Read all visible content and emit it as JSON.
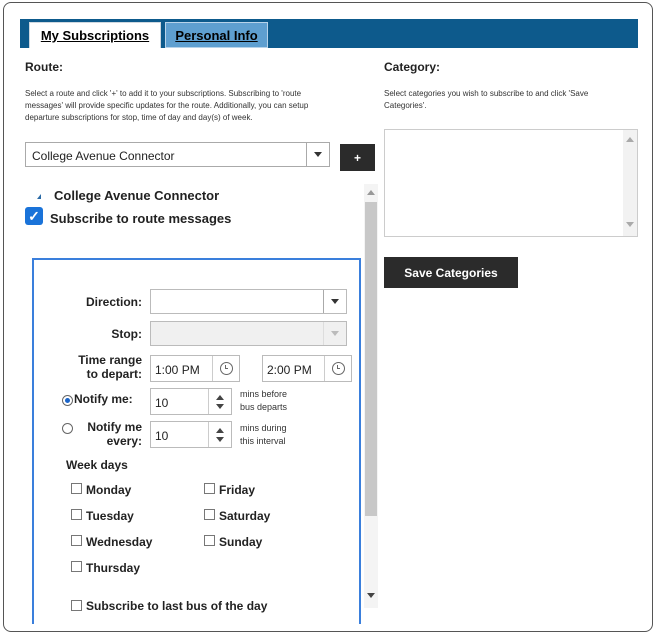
{
  "tabs": [
    {
      "label": "My Subscriptions",
      "active": true
    },
    {
      "label": "Personal Info",
      "active": false
    }
  ],
  "route": {
    "title": "Route:",
    "help_lines": [
      "Select a route and click '+' to add it to your subscriptions. Subscribing to 'route",
      "messages' will provide specific updates for the route. Additionally, you can setup",
      "departure subscriptions for stop, time of day and day(s) of week."
    ],
    "selected": "College Avenue Connector",
    "add_label": "+"
  },
  "route_item": {
    "name": "College Avenue Connector",
    "subscribe_label": "Subscribe to route messages",
    "subscribe_checked": true
  },
  "form": {
    "direction_label": "Direction:",
    "direction_value": "",
    "stop_label": "Stop:",
    "stop_value": "",
    "time_range_label_1": "Time range",
    "time_range_label_2": "to depart:",
    "time_from": "1:00 PM",
    "time_to": "2:00 PM",
    "notify_me_label": "Notify me:",
    "notify_me_selected": true,
    "notify_me_value": "10",
    "notify_me_hint_1": "mins before",
    "notify_me_hint_2": "bus departs",
    "notify_every_label_1": "Notify me",
    "notify_every_label_2": "every:",
    "notify_every_selected": false,
    "notify_every_value": "10",
    "notify_every_hint_1": "mins during",
    "notify_every_hint_2": "this interval",
    "weekdays_title": "Week days",
    "days": [
      {
        "label": "Monday",
        "checked": false
      },
      {
        "label": "Tuesday",
        "checked": false
      },
      {
        "label": "Wednesday",
        "checked": false
      },
      {
        "label": "Thursday",
        "checked": false
      },
      {
        "label": "Friday",
        "checked": false
      },
      {
        "label": "Saturday",
        "checked": false
      },
      {
        "label": "Sunday",
        "checked": false
      }
    ],
    "last_bus_label": "Subscribe to last bus of the day"
  },
  "category": {
    "title": "Category:",
    "help_lines": [
      "Select categories you wish to subscribe to and click 'Save",
      "Categories'."
    ],
    "save_label": "Save Categories"
  },
  "colors": {
    "tabbar": "#0d5a8c",
    "accent": "#3a7fdc",
    "button": "#2b2b2b"
  }
}
